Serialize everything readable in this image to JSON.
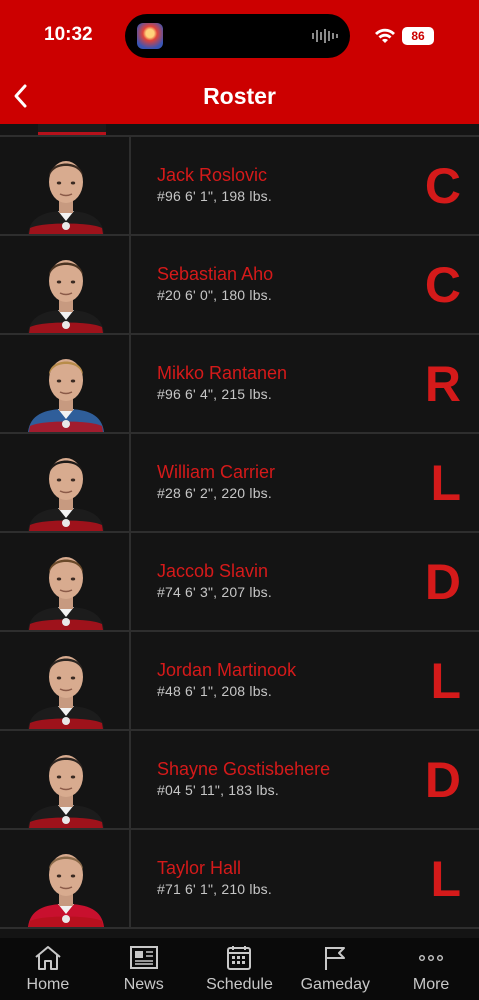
{
  "status": {
    "time": "10:32",
    "battery": "86"
  },
  "header": {
    "title": "Roster"
  },
  "players": [
    {
      "name": "Jack Roslovic",
      "details": "#96 6' 1\", 198 lbs.",
      "position": "C",
      "jersey": "#1c1c1c",
      "hair": "#3a2a20"
    },
    {
      "name": "Sebastian Aho",
      "details": "#20 6' 0\", 180 lbs.",
      "position": "C",
      "jersey": "#1c1c1c",
      "hair": "#4a3422"
    },
    {
      "name": "Mikko Rantanen",
      "details": "#96 6' 4\", 215 lbs.",
      "position": "R",
      "jersey": "#2f5e9a",
      "hair": "#b88c4a"
    },
    {
      "name": "William Carrier",
      "details": "#28 6' 2\", 220 lbs.",
      "position": "L",
      "jersey": "#1c1c1c",
      "hair": "#1e1a18"
    },
    {
      "name": "Jaccob Slavin",
      "details": "#74 6' 3\", 207 lbs.",
      "position": "D",
      "jersey": "#1c1c1c",
      "hair": "#6a4a2a"
    },
    {
      "name": "Jordan Martinook",
      "details": "#48 6' 1\", 208 lbs.",
      "position": "L",
      "jersey": "#1c1c1c",
      "hair": "#2a2420"
    },
    {
      "name": "Shayne Gostisbehere",
      "details": "#04 5' 11\", 183 lbs.",
      "position": "D",
      "jersey": "#1c1c1c",
      "hair": "#2c2420"
    },
    {
      "name": "Taylor Hall",
      "details": "#71 6' 1\", 210 lbs.",
      "position": "L",
      "jersey": "#c8102e",
      "hair": "#8a6a4a"
    }
  ],
  "tabs": [
    {
      "label": "Home",
      "icon": "home-icon"
    },
    {
      "label": "News",
      "icon": "news-icon"
    },
    {
      "label": "Schedule",
      "icon": "calendar-icon"
    },
    {
      "label": "Gameday",
      "icon": "flag-icon"
    },
    {
      "label": "More",
      "icon": "more-dots-icon"
    }
  ],
  "colors": {
    "accent": "#cc0000",
    "text_red": "#d51a1a",
    "background": "#141414"
  }
}
